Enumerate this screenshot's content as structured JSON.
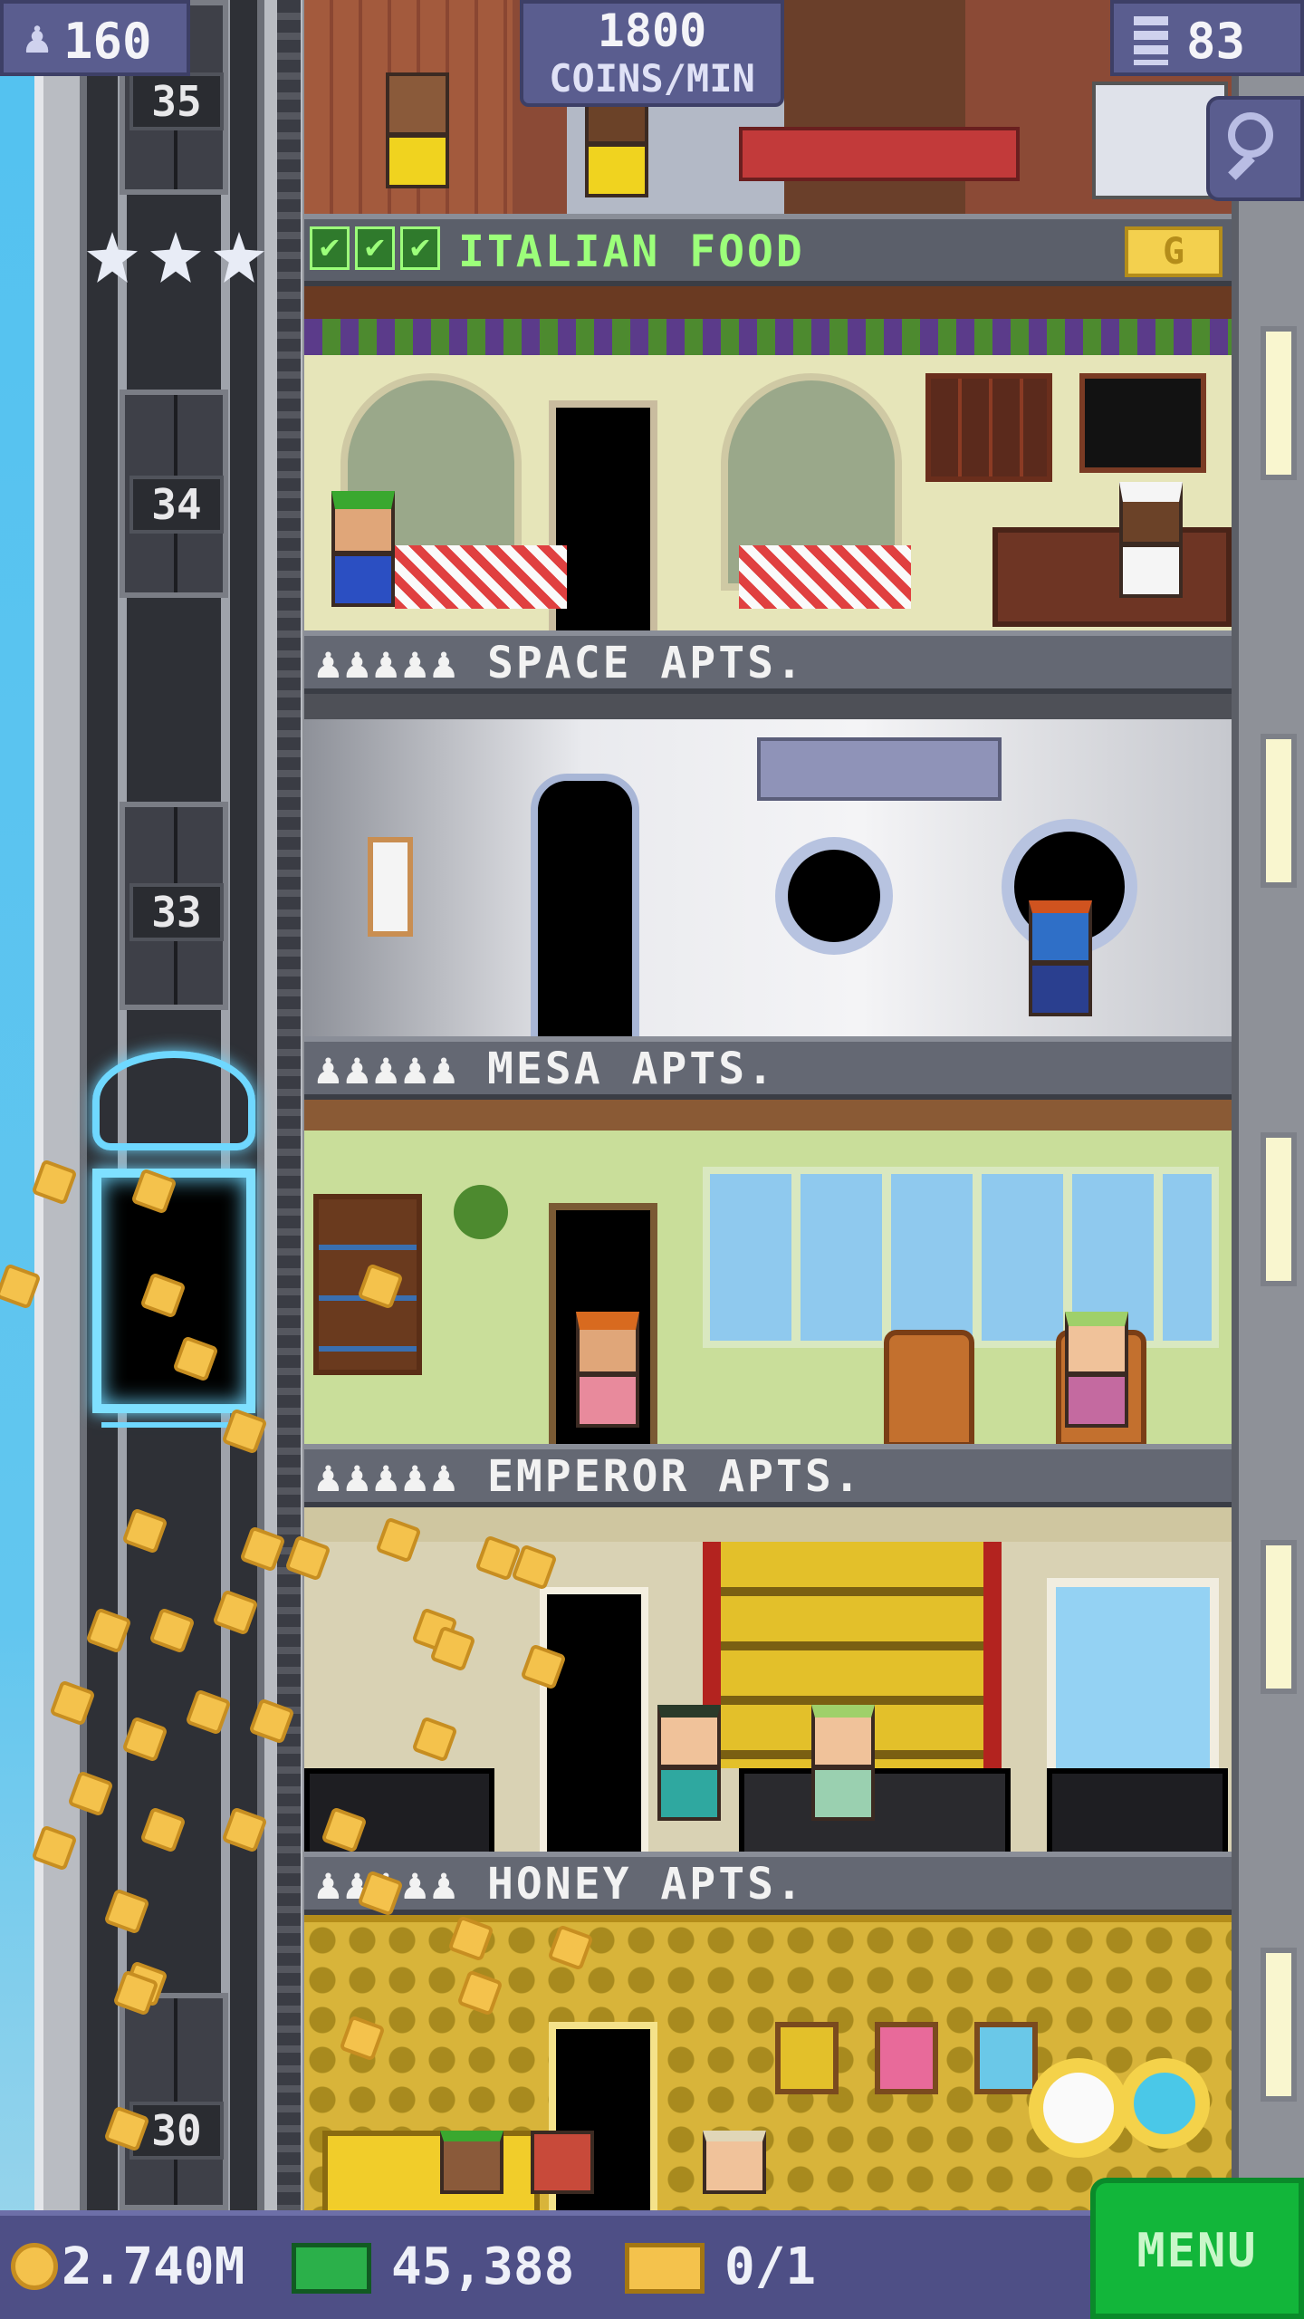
{
  "hud": {
    "population": "160",
    "coins_per_min_value": "1800",
    "coins_per_min_unit": "COINS/MIN",
    "floor_count": "83"
  },
  "elevator": {
    "floor_labels": [
      "35",
      "34",
      "33",
      "30"
    ]
  },
  "floors": [
    {
      "name": "ITALIAN FOOD",
      "stock_checks": 3,
      "rating_stars": 3,
      "badge": "G",
      "type": "food"
    },
    {
      "name": "SPACE APTS.",
      "type": "residential"
    },
    {
      "name": "MESA APTS.",
      "type": "residential"
    },
    {
      "name": "EMPEROR APTS.",
      "type": "residential"
    },
    {
      "name": "HONEY APTS.",
      "type": "residential"
    }
  ],
  "bottom_bar": {
    "coins": "2.740M",
    "bux": "45,388",
    "tickets": "0/1",
    "menu_label": "MENU"
  },
  "colors": {
    "hud_bg": "#5a5d8f",
    "food_name": "#9cff7a",
    "menu_green": "#12b63a",
    "vip_neon": "#6fd8ff",
    "coin_gold": "#f4c24c"
  }
}
